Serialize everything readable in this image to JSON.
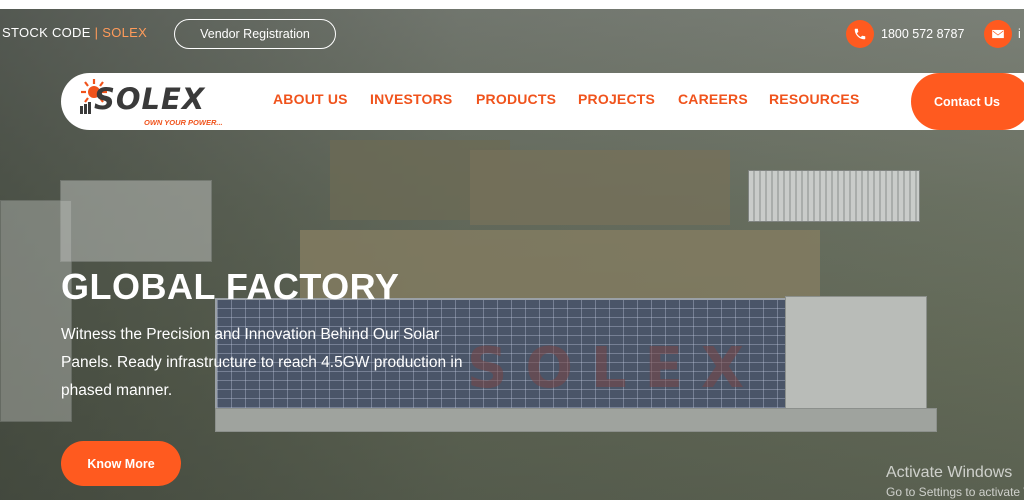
{
  "topbar": {
    "stock_prefix": "STOCK CODE",
    "stock_sep": " | ",
    "stock_code": "SOLEX",
    "vendor_label": "Vendor Registration",
    "phone": "1800 572 8787",
    "email_partial": "i",
    "icons": {
      "phone": "phone-icon",
      "email": "envelope-icon"
    }
  },
  "logo": {
    "brand": "SOLEX",
    "tagline": "OWN YOUR POWER..."
  },
  "nav": {
    "items": [
      {
        "label": "ABOUT US"
      },
      {
        "label": "INVESTORS"
      },
      {
        "label": "PRODUCTS"
      },
      {
        "label": "PROJECTS"
      },
      {
        "label": "CAREERS"
      },
      {
        "label": "RESOURCES"
      }
    ],
    "contact_label": "Contact Us"
  },
  "hero": {
    "title": "GLOBAL FACTORY",
    "description": "Witness the Precision and Innovation Behind Our Solar Panels. Ready infrastructure to reach 4.5GW production in phased manner.",
    "cta_label": "Know More",
    "roof_watermark": "SOLEX"
  },
  "os_overlay": {
    "title": "Activate Windows",
    "subtitle": "Go to Settings to activate Windows."
  },
  "colors": {
    "accent": "#ff5a1f",
    "nav_text": "#f0531c",
    "white": "#ffffff"
  }
}
